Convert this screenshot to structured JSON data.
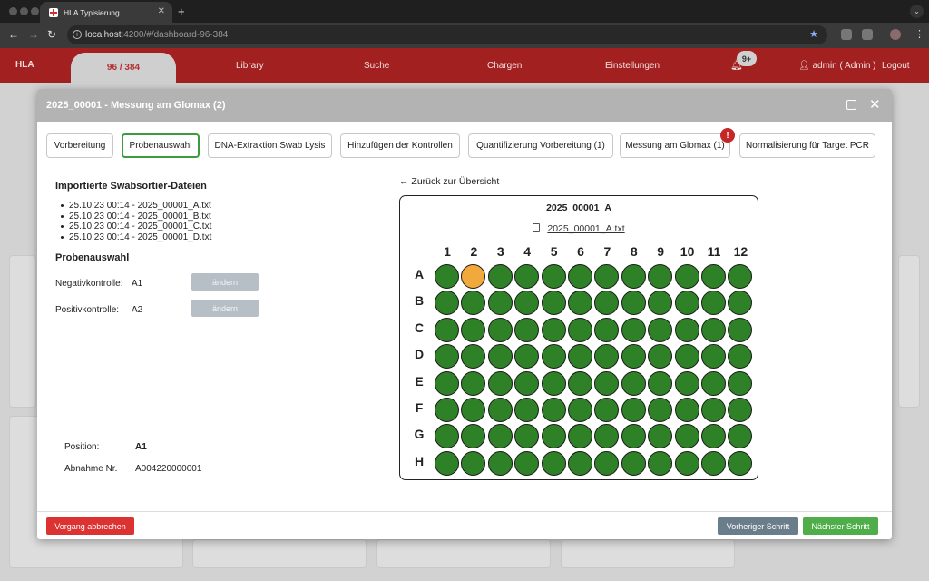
{
  "browser": {
    "tab_title": "HLA Typisierung",
    "url_host": "localhost",
    "url_path": ":4200/#/dashboard-96-384"
  },
  "app_nav": {
    "brand": "HLA",
    "active_tab": "96 / 384",
    "links": [
      "Library",
      "Suche",
      "Chargen",
      "Einstellungen"
    ],
    "notification_count": "9+",
    "user": "admin ( Admin )",
    "logout": "Logout"
  },
  "modal": {
    "title": "2025_00001 - Messung am Glomax (2)",
    "steps": [
      {
        "label": "Vorbereitung",
        "active": false
      },
      {
        "label": "Probenauswahl",
        "active": true
      },
      {
        "label": "DNA-Extraktion Swab Lysis",
        "active": false
      },
      {
        "label": "Hinzufügen der Kontrollen",
        "active": false
      },
      {
        "label": "Quantifizierung Vorbereitung (1)",
        "active": false
      },
      {
        "label": "Messung am Glomax (1)",
        "active": false,
        "alert": "!"
      },
      {
        "label": "Normalisierung für Target PCR",
        "active": false
      }
    ],
    "imported_title": "Importierte Swabsortier-Dateien",
    "files": [
      "25.10.23 00:14 - 2025_00001_A.txt",
      "25.10.23 00:14 - 2025_00001_B.txt",
      "25.10.23 00:14 - 2025_00001_C.txt",
      "25.10.23 00:14 - 2025_00001_D.txt"
    ],
    "probe_title": "Probenauswahl",
    "negative_label": "Negativkontrolle:",
    "negative_value": "A1",
    "positive_label": "Positivkontrolle:",
    "positive_value": "A2",
    "change_label": "ändern",
    "position_label": "Position:",
    "position_value": "A1",
    "abnahme_label": "Abnahme Nr.",
    "abnahme_value": "A004220000001",
    "back_link": "← Zurück zur Übersicht",
    "plate_title": "2025_00001_A",
    "plate_file": "2025_00001_A.txt",
    "columns": [
      "1",
      "2",
      "3",
      "4",
      "5",
      "6",
      "7",
      "8",
      "9",
      "10",
      "11",
      "12"
    ],
    "rows": [
      "A",
      "B",
      "C",
      "D",
      "E",
      "F",
      "G",
      "H"
    ],
    "selected_well": "A2",
    "well_color": "#2e8127",
    "selected_color": "#f2a93b",
    "cancel": "Vorgang abbrechen",
    "prev": "Vorheriger Schritt",
    "next": "Nächster Schritt"
  }
}
